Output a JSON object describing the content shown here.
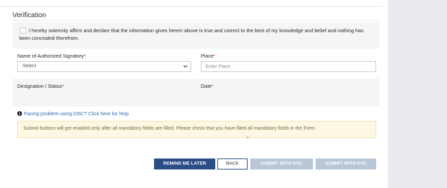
{
  "verification": {
    "title": "Verification",
    "declaration_text": "I hereby solemnly affirm and declare that the information given herein above is true and correct to the best of my knowledge and belief and nothing has been concealed therefrom.",
    "declaration_checked": false
  },
  "form": {
    "signatory_label": "Name of Authorized Signatory",
    "signatory_value": "Select",
    "place_label": "Place",
    "place_placeholder": "Enter Place",
    "designation_label": "Designation / Status",
    "date_label": "Date",
    "required_mark": "*"
  },
  "help": {
    "dsc_link": "Facing problem using DSC? Click here for help"
  },
  "notice": {
    "text": "Submit buttons will get enabled only after all mandatory fields are filled. Please check that you have filled all mandatory fields in the Form."
  },
  "actions": {
    "remind_later": "REMIND ME LATER",
    "back": "BACK",
    "submit_dsc": "SUBMIT WITH DSC",
    "submit_evc": "SUBMIT WITH EVC"
  },
  "colors": {
    "primary": "#2c4e86",
    "disabled": "#b9c6d8",
    "required": "#d9232d",
    "link": "#2b6cb3",
    "notice_bg": "#fcf8e3"
  },
  "icons": {
    "info": "info-circle-icon",
    "dropdown": "chevron-down-icon"
  }
}
